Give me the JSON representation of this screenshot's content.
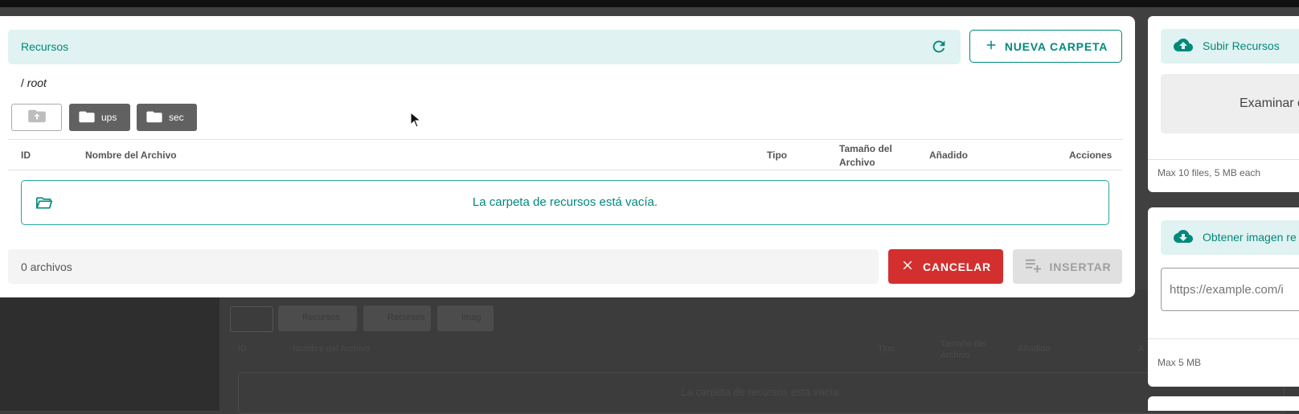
{
  "dialog": {
    "title": "Recursos",
    "new_folder_label": "NUEVA CARPETA",
    "path_prefix": "/ ",
    "path_root": "root",
    "folders": [
      "ups",
      "sec"
    ],
    "table_headers": {
      "id": "ID",
      "name": "Nombre del Archivo",
      "type": "Tipo",
      "size": "Tamaño del Archivo",
      "added": "Añadido",
      "actions": "Acciones"
    },
    "empty_message": "La carpeta de recursos está vacía.",
    "file_count": "0 archivos",
    "cancel_label": "CANCELAR",
    "insert_label": "INSERTAR"
  },
  "upload_panel": {
    "title": "Subir Recursos",
    "dropzone_text": "Examinar o S",
    "note": "Max 10 files, 5 MB each"
  },
  "url_panel": {
    "title": "Obtener imagen re",
    "url_placeholder": "https://example.com/i",
    "note": "Max 5 MB"
  },
  "background": {
    "folders": [
      "Recursos",
      "Recursos",
      "Imag"
    ],
    "headers": [
      "ID",
      "Nombre del Archivo",
      "Tipo",
      "Tamaño del Archivo",
      "Añadido",
      "A"
    ],
    "empty_message": "La carpeta de recursos está vacía."
  },
  "colors": {
    "accent": "#00897b",
    "accent_light": "#e0f2f1",
    "danger": "#d32f2f",
    "disabled": "#e0e0e0",
    "folder_chip": "#616161"
  }
}
